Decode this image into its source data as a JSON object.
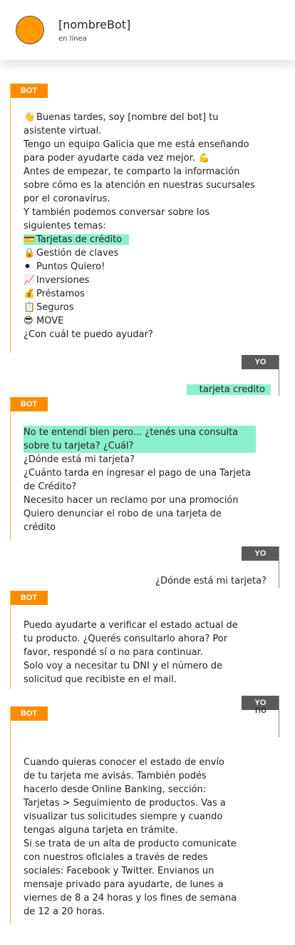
{
  "header": {
    "name": "[nombreBot]",
    "status": "en línea"
  },
  "labels": {
    "bot": "BOT",
    "user": "YO"
  },
  "messages": {
    "bot1": {
      "greeting": "Buenas tardes, soy [nombre del bot] tu",
      "l2": "asistente virtual.",
      "l3": "Tengo un equipo Galicia que me está enseñando",
      "l4": "para poder ayudarte cada vez mejor.",
      "l5": "Antes de empezar, te comparto la información",
      "l6": "sobre cómo es la atención en nuestras sucursales",
      "l7": "por el coronavirus.",
      "l8": "Y también podemos conversar sobre los",
      "l9": "siguientes temas:",
      "topics": [
        "Tarjetas de crédito",
        "Gestión de claves",
        "Puntos Quiero!",
        "Inversiones",
        "Préstamos",
        "Seguros",
        "MOVE"
      ],
      "closing": "¿Con cuál te puedo ayudar?"
    },
    "user1": "tarjeta credito",
    "bot2": {
      "l1": "No te entendí bien pero... ¿tenés una consulta",
      "l2": "sobre tu tarjeta? ¿Cuál?",
      "l3": "¿Dónde está mi tarjeta?",
      "l4": "¿Cuánto tarda en ingresar el pago de una Tarjeta",
      "l5": "de Crédito?",
      "l6": "Necesito hacer un reclamo por una promoción",
      "l7": "Quiero denunciar el robo de una tarjeta de",
      "l8": "crédito"
    },
    "user2": "¿Dónde está mi tarjeta?",
    "bot3": {
      "l1": "Puedo ayudarte a verificar el estado actual de",
      "l2": "tu producto. ¿Querés consultarlo ahora? Por",
      "l3": "favor, respondé sí o no para continuar.",
      "l4": "Solo voy a necesitar tu DNI y el número de",
      "l5": "solicitud que recibiste en el mail."
    },
    "user3": "no",
    "bot4": {
      "l1": "Cuando quieras conocer el estado de envío",
      "l2": "de tu tarjeta me avisás. También podés",
      "l3": "hacerlo desde Online Banking, sección:",
      "l4": "Tarjetas > Seguimiento de productos. Vas a",
      "l5": "visualizar tus solicitudes siempre y cuando",
      "l6": "tengas alguna tarjeta en trámite.",
      "l7": "Si se trata de un alta de producto comunicate",
      "l8": "con nuestros oficiales a través de redes",
      "l9": "sociales: Facebook y Twitter. Envianos un",
      "l10": "mensaje privado para ayudarte, de lunes a",
      "l11": "viernes de 8 a 24 horas y los fines de semana",
      "l12": "de 12 a 20 horas."
    }
  },
  "icons": [
    "waving-hand",
    "flexed-biceps",
    "credit-card",
    "lock",
    "black-circle",
    "chart-increasing",
    "money-bag",
    "clipboard",
    "sunglasses-face"
  ]
}
